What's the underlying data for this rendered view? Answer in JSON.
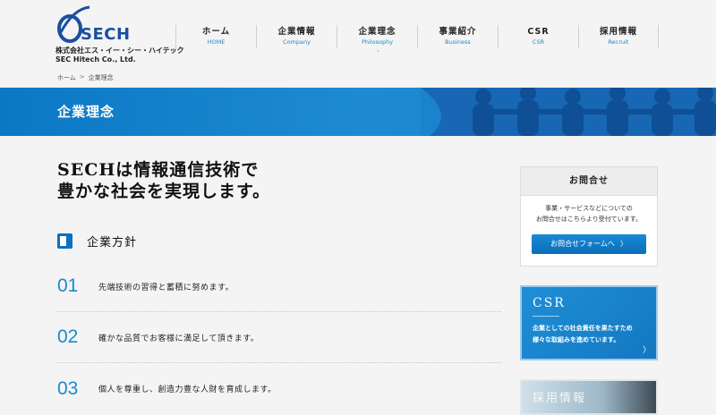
{
  "logo": {
    "word": "SECH",
    "company_ja": "株式会社エス・イー・シー・ハイテック",
    "company_en": "SEC Hitech Co., Ltd."
  },
  "nav": {
    "items": [
      {
        "ja": "ホーム",
        "en": "HOME"
      },
      {
        "ja": "企業情報",
        "en": "Company"
      },
      {
        "ja": "企業理念",
        "en": "Philosophy"
      },
      {
        "ja": "事業紹介",
        "en": "Business"
      },
      {
        "ja": "CSR",
        "en": "CSR"
      },
      {
        "ja": "採用情報",
        "en": "Recruit"
      }
    ],
    "active_marker": "⌄"
  },
  "breadcrumb": {
    "home": "ホーム",
    "separator": ">",
    "current": "企業理念"
  },
  "banner": {
    "title": "企業理念"
  },
  "main": {
    "headline_line1": "SECHは情報通信技術で",
    "headline_line2": "豊かな社会を実現します。",
    "section_title": "企業方針",
    "policies": [
      {
        "num": "01",
        "text": "先端技術の習得と蓄積に努めます。"
      },
      {
        "num": "02",
        "text": "確かな品質でお客様に満足して頂きます。"
      },
      {
        "num": "03",
        "text": "個人を尊重し、創造力豊な人財を育成します。"
      }
    ]
  },
  "sidebar": {
    "contact": {
      "title": "お問合せ",
      "desc_line1": "事業・サービスなどについての",
      "desc_line2": "お問合せはこちらより受付ています。",
      "button": "お問合せフォームへ",
      "button_arrow": "〉"
    },
    "csr": {
      "title": "CSR",
      "desc_line1": "企業としての社会責任を果たすため",
      "desc_line2": "様々な取組みを進めています。",
      "arrow": "〉"
    },
    "recruit": {
      "title": "採用情報"
    }
  },
  "colors": {
    "brand_blue": "#1a4fa0",
    "accent_blue": "#1a8acb",
    "banner_blue": "#1b83cd"
  }
}
